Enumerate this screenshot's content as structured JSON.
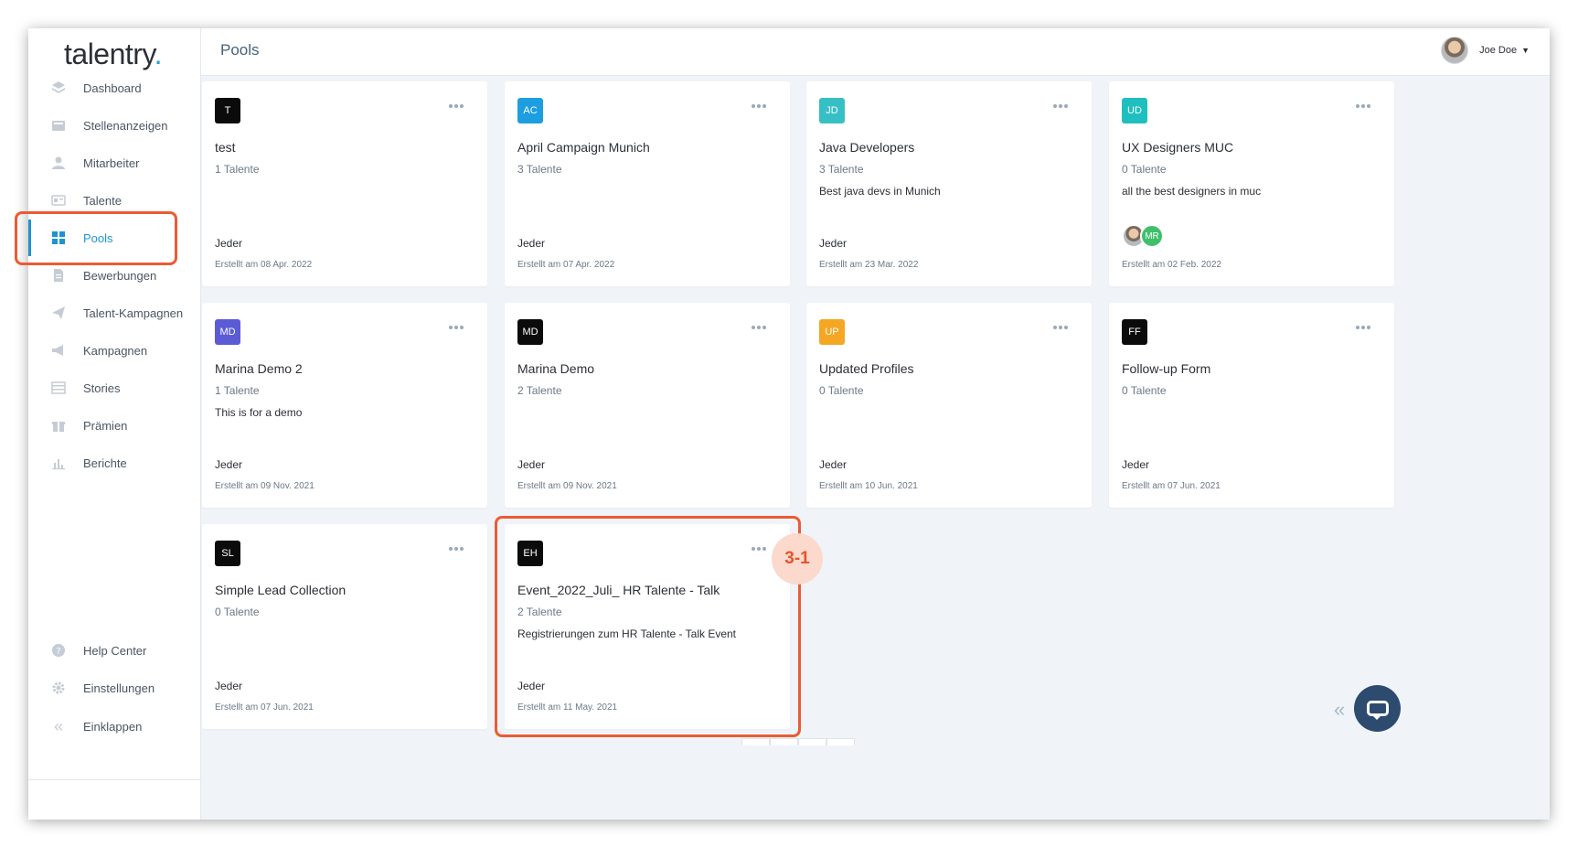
{
  "app": {
    "logo": "talentry",
    "logo_dot": "."
  },
  "header": {
    "title": "Pools",
    "user_name": "Joe Doe"
  },
  "sidebar": {
    "items": [
      {
        "label": "Dashboard",
        "icon": "layers-icon"
      },
      {
        "label": "Stellenanzeigen",
        "icon": "inbox-icon"
      },
      {
        "label": "Mitarbeiter",
        "icon": "user-icon"
      },
      {
        "label": "Talente",
        "icon": "id-card-icon"
      },
      {
        "label": "Pools",
        "icon": "grid-icon",
        "active": true
      },
      {
        "label": "Bewerbungen",
        "icon": "document-icon"
      },
      {
        "label": "Talent-Kampagnen",
        "icon": "paper-plane-icon"
      },
      {
        "label": "Kampagnen",
        "icon": "megaphone-icon"
      },
      {
        "label": "Stories",
        "icon": "layout-icon"
      },
      {
        "label": "Prämien",
        "icon": "gift-icon"
      },
      {
        "label": "Berichte",
        "icon": "bar-chart-icon"
      }
    ],
    "bottom_items": [
      {
        "label": "Help Center",
        "icon": "question-icon"
      },
      {
        "label": "Einstellungen",
        "icon": "gear-icon"
      }
    ],
    "collapse_label": "Einklappen"
  },
  "pools": [
    {
      "initials": "T",
      "color": "#0b0b0b",
      "title": "test",
      "count": "1 Talente",
      "description": "",
      "owner": "Jeder",
      "created": "Erstellt am 08 Apr. 2022"
    },
    {
      "initials": "AC",
      "color": "#1d9ee0",
      "title": "April Campaign Munich",
      "count": "3 Talente",
      "description": "",
      "owner": "Jeder",
      "created": "Erstellt am 07 Apr. 2022"
    },
    {
      "initials": "JD",
      "color": "#36c0c6",
      "title": "Java Developers",
      "count": "3 Talente",
      "description": "Best java devs in Munich",
      "owner": "Jeder",
      "created": "Erstellt am 23 Mar. 2022"
    },
    {
      "initials": "UD",
      "color": "#1fbfbf",
      "title": "UX Designers MUC",
      "count": "0 Talente",
      "description": "all the best designers in muc",
      "owner": "",
      "members": [
        "MR"
      ],
      "created": "Erstellt am 02 Feb. 2022"
    },
    {
      "initials": "MD",
      "color": "#5b5bd6",
      "title": "Marina Demo 2",
      "count": "1 Talente",
      "description": "This is for a demo",
      "owner": "Jeder",
      "created": "Erstellt am 09 Nov. 2021"
    },
    {
      "initials": "MD",
      "color": "#0b0b0b",
      "title": "Marina Demo",
      "count": "2 Talente",
      "description": "",
      "owner": "Jeder",
      "created": "Erstellt am 09 Nov. 2021"
    },
    {
      "initials": "UP",
      "color": "#f5a623",
      "title": "Updated Profiles",
      "count": "0 Talente",
      "description": "",
      "owner": "Jeder",
      "created": "Erstellt am 10 Jun. 2021"
    },
    {
      "initials": "FF",
      "color": "#0b0b0b",
      "title": "Follow-up Form",
      "count": "0 Talente",
      "description": "",
      "owner": "Jeder",
      "created": "Erstellt am 07 Jun. 2021"
    },
    {
      "initials": "SL",
      "color": "#0b0b0b",
      "title": "Simple Lead Collection",
      "count": "0 Talente",
      "description": "",
      "owner": "Jeder",
      "created": "Erstellt am 07 Jun. 2021"
    },
    {
      "initials": "EH",
      "color": "#0b0b0b",
      "title": "Event_2022_Juli_ HR Talente - Talk",
      "count": "2 Talente",
      "description": "Registrierungen zum HR Talente - Talk Event",
      "owner": "Jeder",
      "created": "Erstellt am 11 May. 2021"
    }
  ],
  "annotation": {
    "step_label": "3-1",
    "color": "#ec5b33"
  }
}
